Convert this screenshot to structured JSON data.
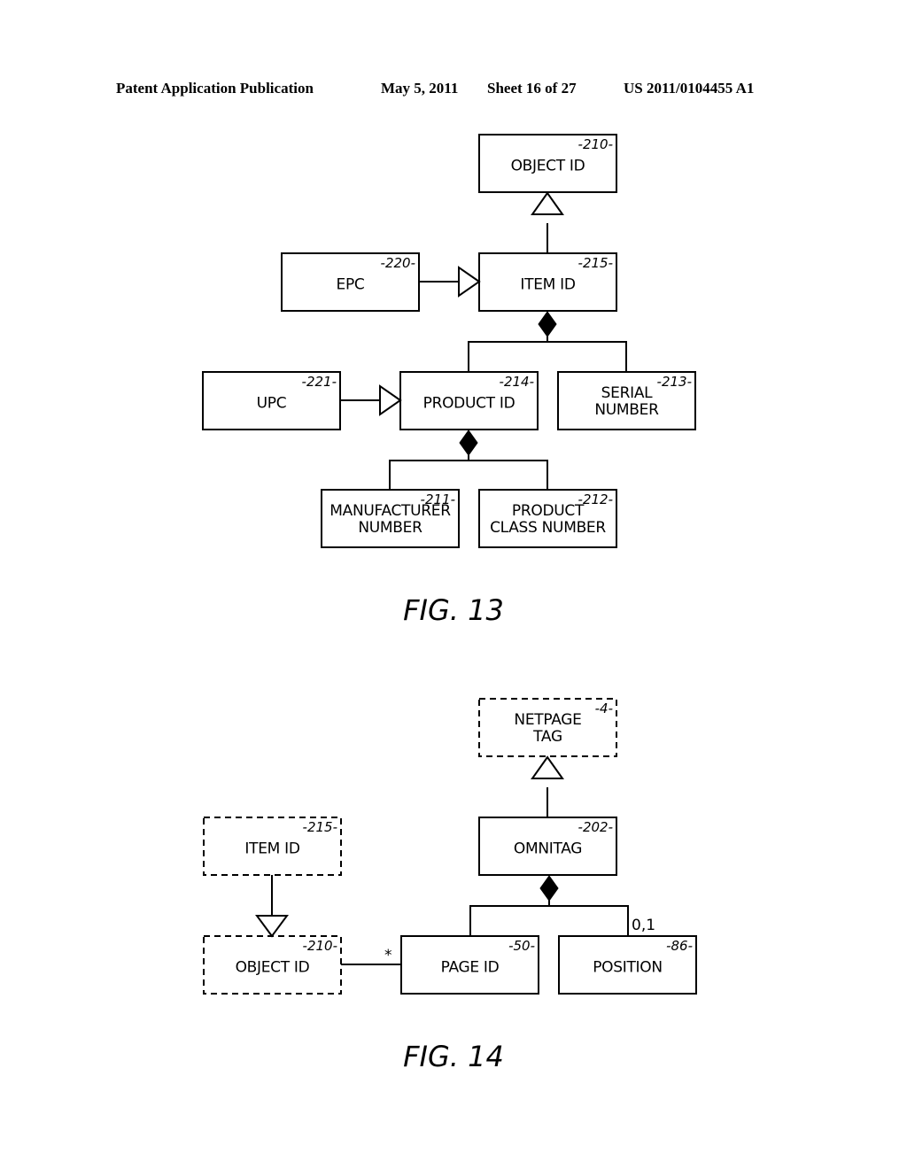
{
  "header": {
    "publication": "Patent Application Publication",
    "date": "May 5, 2011",
    "sheet": "Sheet 16 of 27",
    "number": "US 2011/0104455 A1"
  },
  "fig13": {
    "caption": "FIG. 13",
    "boxes": {
      "object_id": {
        "label": [
          "OBJECT ID"
        ],
        "ref": "-210-",
        "style": "solid"
      },
      "item_id": {
        "label": [
          "ITEM ID"
        ],
        "ref": "-215-",
        "style": "solid"
      },
      "epc": {
        "label": [
          "EPC"
        ],
        "ref": "-220-",
        "style": "solid"
      },
      "upc": {
        "label": [
          "UPC"
        ],
        "ref": "-221-",
        "style": "solid"
      },
      "product_id": {
        "label": [
          "PRODUCT ID"
        ],
        "ref": "-214-",
        "style": "solid"
      },
      "serial_number": {
        "label": [
          "SERIAL",
          "NUMBER"
        ],
        "ref": "-213-",
        "style": "solid"
      },
      "manufacturer_number": {
        "label": [
          "MANUFACTURER",
          "NUMBER"
        ],
        "ref": "-211-",
        "style": "solid"
      },
      "product_class_number": {
        "label": [
          "PRODUCT",
          "CLASS NUMBER"
        ],
        "ref": "-212-",
        "style": "solid"
      }
    },
    "relations": [
      {
        "type": "generalization",
        "from": "item_id",
        "to": "object_id"
      },
      {
        "type": "generalization",
        "from": "epc",
        "to": "item_id"
      },
      {
        "type": "generalization",
        "from": "upc",
        "to": "product_id"
      },
      {
        "type": "composition",
        "whole": "item_id",
        "parts": [
          "product_id",
          "serial_number"
        ]
      },
      {
        "type": "composition",
        "whole": "product_id",
        "parts": [
          "manufacturer_number",
          "product_class_number"
        ]
      }
    ]
  },
  "fig14": {
    "caption": "FIG. 14",
    "boxes": {
      "netpage_tag": {
        "label": [
          "NETPAGE",
          "TAG"
        ],
        "ref": "-4-",
        "style": "dashed"
      },
      "omnitag": {
        "label": [
          "OMNITAG"
        ],
        "ref": "-202-",
        "style": "solid"
      },
      "item_id": {
        "label": [
          "ITEM ID"
        ],
        "ref": "-215-",
        "style": "dashed"
      },
      "object_id": {
        "label": [
          "OBJECT ID"
        ],
        "ref": "-210-",
        "style": "dashed"
      },
      "page_id": {
        "label": [
          "PAGE ID"
        ],
        "ref": "-50-",
        "style": "solid"
      },
      "position": {
        "label": [
          "POSITION"
        ],
        "ref": "-86-",
        "style": "solid"
      }
    },
    "relations": [
      {
        "type": "generalization",
        "from": "omnitag",
        "to": "netpage_tag"
      },
      {
        "type": "generalization",
        "from": "item_id",
        "to": "object_id"
      },
      {
        "type": "composition",
        "whole": "omnitag",
        "parts": [
          "page_id",
          "position"
        ]
      },
      {
        "type": "association",
        "from": "object_id",
        "to": "page_id",
        "multiplicity": "*"
      }
    ],
    "multiplicities": {
      "position": "0,1",
      "object_to_page": "*"
    }
  }
}
